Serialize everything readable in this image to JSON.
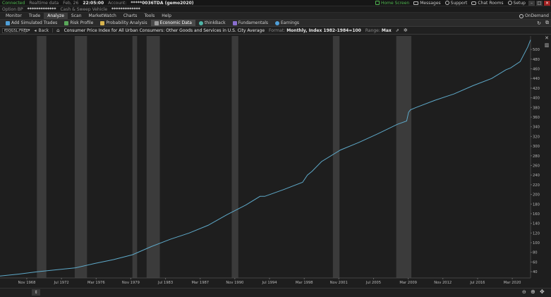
{
  "status_bar": {
    "connection": "Connected",
    "data_mode": "Realtime data",
    "date": "Feb, 26",
    "time": "22:05:00",
    "account_label": "Account:",
    "account_id": "*****0036TDA (gemo2020)",
    "home_screen": "Home Screen",
    "messages": "Messages",
    "support": "Support",
    "chat_rooms": "Chat Rooms",
    "setup": "Setup"
  },
  "account_bar": {
    "option_bp_label": "Option BP",
    "option_bp_value": "*************",
    "cash_label": "Cash & Sweep Vehicle",
    "cash_value": "*************"
  },
  "main_nav": {
    "tabs": [
      "Monitor",
      "Trade",
      "Analyze",
      "Scan",
      "MarketWatch",
      "Charts",
      "Tools",
      "Help"
    ],
    "active": "Analyze",
    "ondemand": "OnDemand"
  },
  "sub_nav": {
    "tabs": [
      "Add Simulated Trades",
      "Risk Profile",
      "Probability Analysis",
      "Economic Data",
      "thinkBack",
      "Fundamentals",
      "Earnings"
    ],
    "active": "Economic Data"
  },
  "symbol_bar": {
    "symbol": "fDQGSL:FRED",
    "back": "Back",
    "series_title": "Consumer Price Index for All Urban Consumers: Other Goods and Services in U.S. City Average",
    "format_label": "Format:",
    "format_value": "Monthly, Index 1982-1984=100",
    "range_label": "Range:",
    "range_value": "Max"
  },
  "colors": {
    "line": "#5ea9c9",
    "shade": "#3b3b3b",
    "background": "#1e1e1e",
    "connected": "#4fb54f"
  },
  "chart_data": {
    "type": "line",
    "title": "",
    "xlabel": "",
    "ylabel": "",
    "x_ticks": [
      "Nov 1968",
      "Jul 1972",
      "Mar 1976",
      "Nov 1979",
      "Jul 1983",
      "Mar 1987",
      "Nov 1990",
      "Jul 1994",
      "Mar 1998",
      "Nov 2001",
      "Jul 2005",
      "Mar 2009",
      "Nov 2012",
      "Jul 2016",
      "Mar 2020"
    ],
    "x_tick_years": [
      1968.83,
      1972.5,
      1976.17,
      1979.83,
      1983.5,
      1987.17,
      1990.83,
      1994.5,
      1998.17,
      2001.83,
      2005.5,
      2009.17,
      2012.83,
      2016.5,
      2020.17
    ],
    "xlim": [
      1966,
      2022.1
    ],
    "y_ticks": [
      40,
      60,
      80,
      100,
      120,
      140,
      160,
      180,
      200,
      220,
      240,
      260,
      280,
      300,
      320,
      340,
      360,
      380,
      400,
      420,
      440,
      460,
      480,
      500
    ],
    "ylim": [
      27,
      528
    ],
    "recessions": [
      [
        1969.9,
        1970.9
      ],
      [
        1973.9,
        1975.2
      ],
      [
        1980.0,
        1980.5
      ],
      [
        1981.5,
        1982.9
      ],
      [
        1990.5,
        1991.2
      ],
      [
        2001.2,
        2001.9
      ],
      [
        2007.9,
        2009.5
      ]
    ],
    "series": [
      {
        "x": [
          1966.0,
          1968.0,
          1970.0,
          1972.0,
          1974.0,
          1976.0,
          1978.0,
          1980.0,
          1982.0,
          1984.0,
          1986.0,
          1988.0,
          1990.0,
          1992.0,
          1993.5,
          1994.0,
          1996.0,
          1998.0,
          1998.5,
          1999.0,
          2000.0,
          2002.0,
          2004.0,
          2006.0,
          2008.0,
          2009.0,
          2009.2,
          2009.4,
          2010.0,
          2012.0,
          2014.0,
          2016.0,
          2018.0,
          2019.5,
          2020.0,
          2021.0,
          2021.8,
          2022.1
        ],
        "y": [
          31,
          35,
          40,
          44,
          48,
          57,
          65,
          75,
          92,
          107,
          120,
          136,
          158,
          178,
          196,
          196,
          210,
          225,
          240,
          248,
          268,
          292,
          308,
          326,
          345,
          352,
          370,
          375,
          380,
          395,
          408,
          425,
          440,
          458,
          462,
          475,
          505,
          520
        ]
      }
    ]
  }
}
